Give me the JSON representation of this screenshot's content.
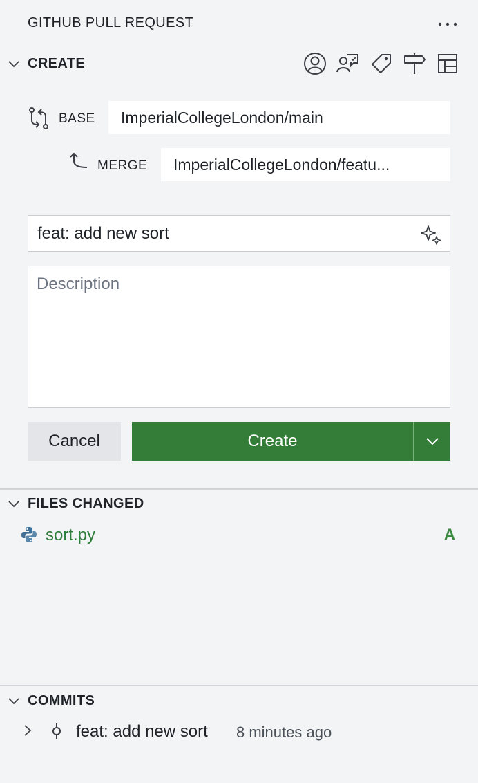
{
  "panel": {
    "title": "GITHUB PULL REQUEST"
  },
  "create_section": {
    "header": "CREATE",
    "toolbar_icons": [
      "account-icon",
      "request-reviewers-icon",
      "tag-icon",
      "milestone-icon",
      "project-icon"
    ],
    "base": {
      "label": "BASE",
      "value": "ImperialCollegeLondon/main"
    },
    "merge": {
      "label": "MERGE",
      "value": "ImperialCollegeLondon/featu..."
    },
    "title_input": {
      "value": "feat: add new sort"
    },
    "description": {
      "placeholder": "Description",
      "value": ""
    },
    "cancel_label": "Cancel",
    "create_label": "Create"
  },
  "files_section": {
    "header": "FILES CHANGED",
    "files": [
      {
        "name": "sort.py",
        "status": "A",
        "icon": "python-icon"
      }
    ]
  },
  "commits_section": {
    "header": "COMMITS",
    "commits": [
      {
        "message": "feat: add new sort",
        "time": "8 minutes ago"
      }
    ]
  },
  "colors": {
    "background": "#f3f4f6",
    "create_button": "#347d39",
    "added_file": "#2e7d3a"
  }
}
